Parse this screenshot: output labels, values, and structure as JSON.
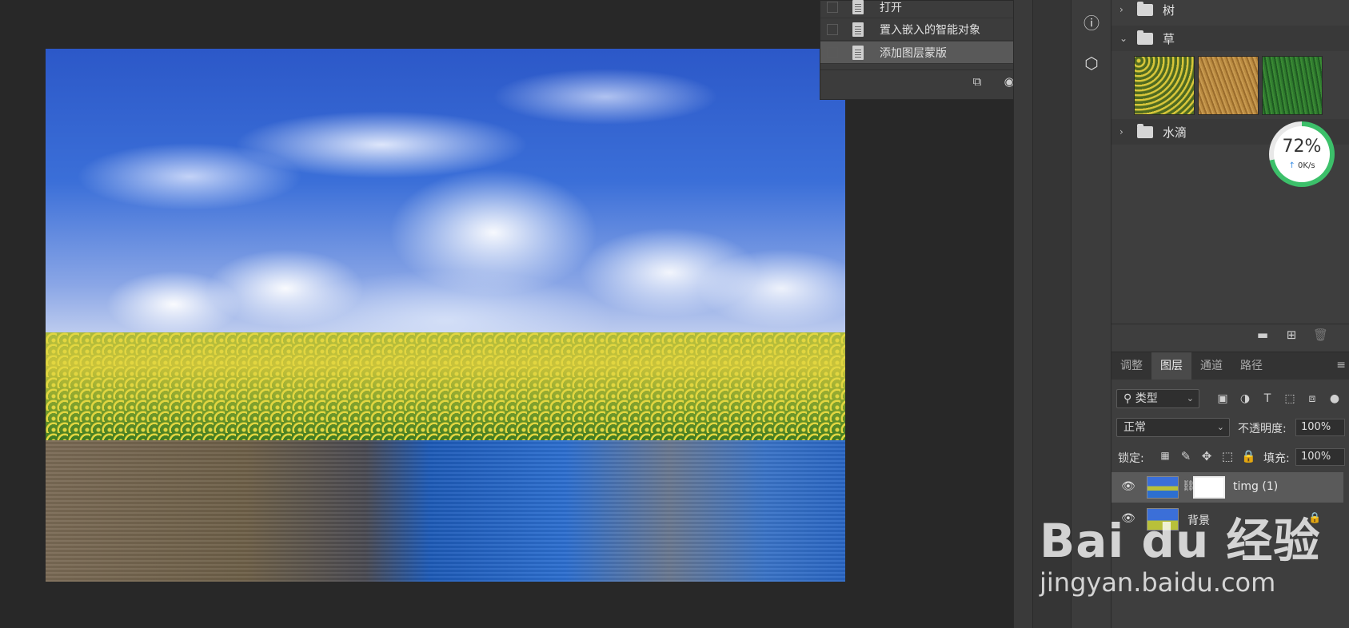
{
  "history": {
    "items": [
      {
        "label": "打开"
      },
      {
        "label": "置入嵌入的智能对象"
      },
      {
        "label": "添加图层蒙版",
        "selected": true
      }
    ]
  },
  "libraries": {
    "groups": [
      {
        "name": "树",
        "expanded": false
      },
      {
        "name": "草",
        "expanded": true
      },
      {
        "name": "水滴",
        "expanded": false
      }
    ]
  },
  "speed_badge": {
    "percent": "72%",
    "rate": "0K/s"
  },
  "layers_panel": {
    "tabs": [
      "调整",
      "图层",
      "通道",
      "路径"
    ],
    "active_tab": "图层",
    "filter_type": "类型",
    "blend_mode": "正常",
    "opacity_label": "不透明度:",
    "opacity_value": "100%",
    "lock_label": "锁定:",
    "fill_label": "填充:",
    "fill_value": "100%",
    "layers": [
      {
        "name": "timg (1)",
        "selected": true,
        "has_mask": true
      },
      {
        "name": "背景",
        "locked": true
      }
    ]
  },
  "watermark": {
    "logo": "Bai du 经验",
    "url": "jingyan.baidu.com"
  },
  "colors": {
    "panel_bg": "#3e3e3e",
    "workspace_bg": "#282828",
    "selected_row": "#595959"
  }
}
